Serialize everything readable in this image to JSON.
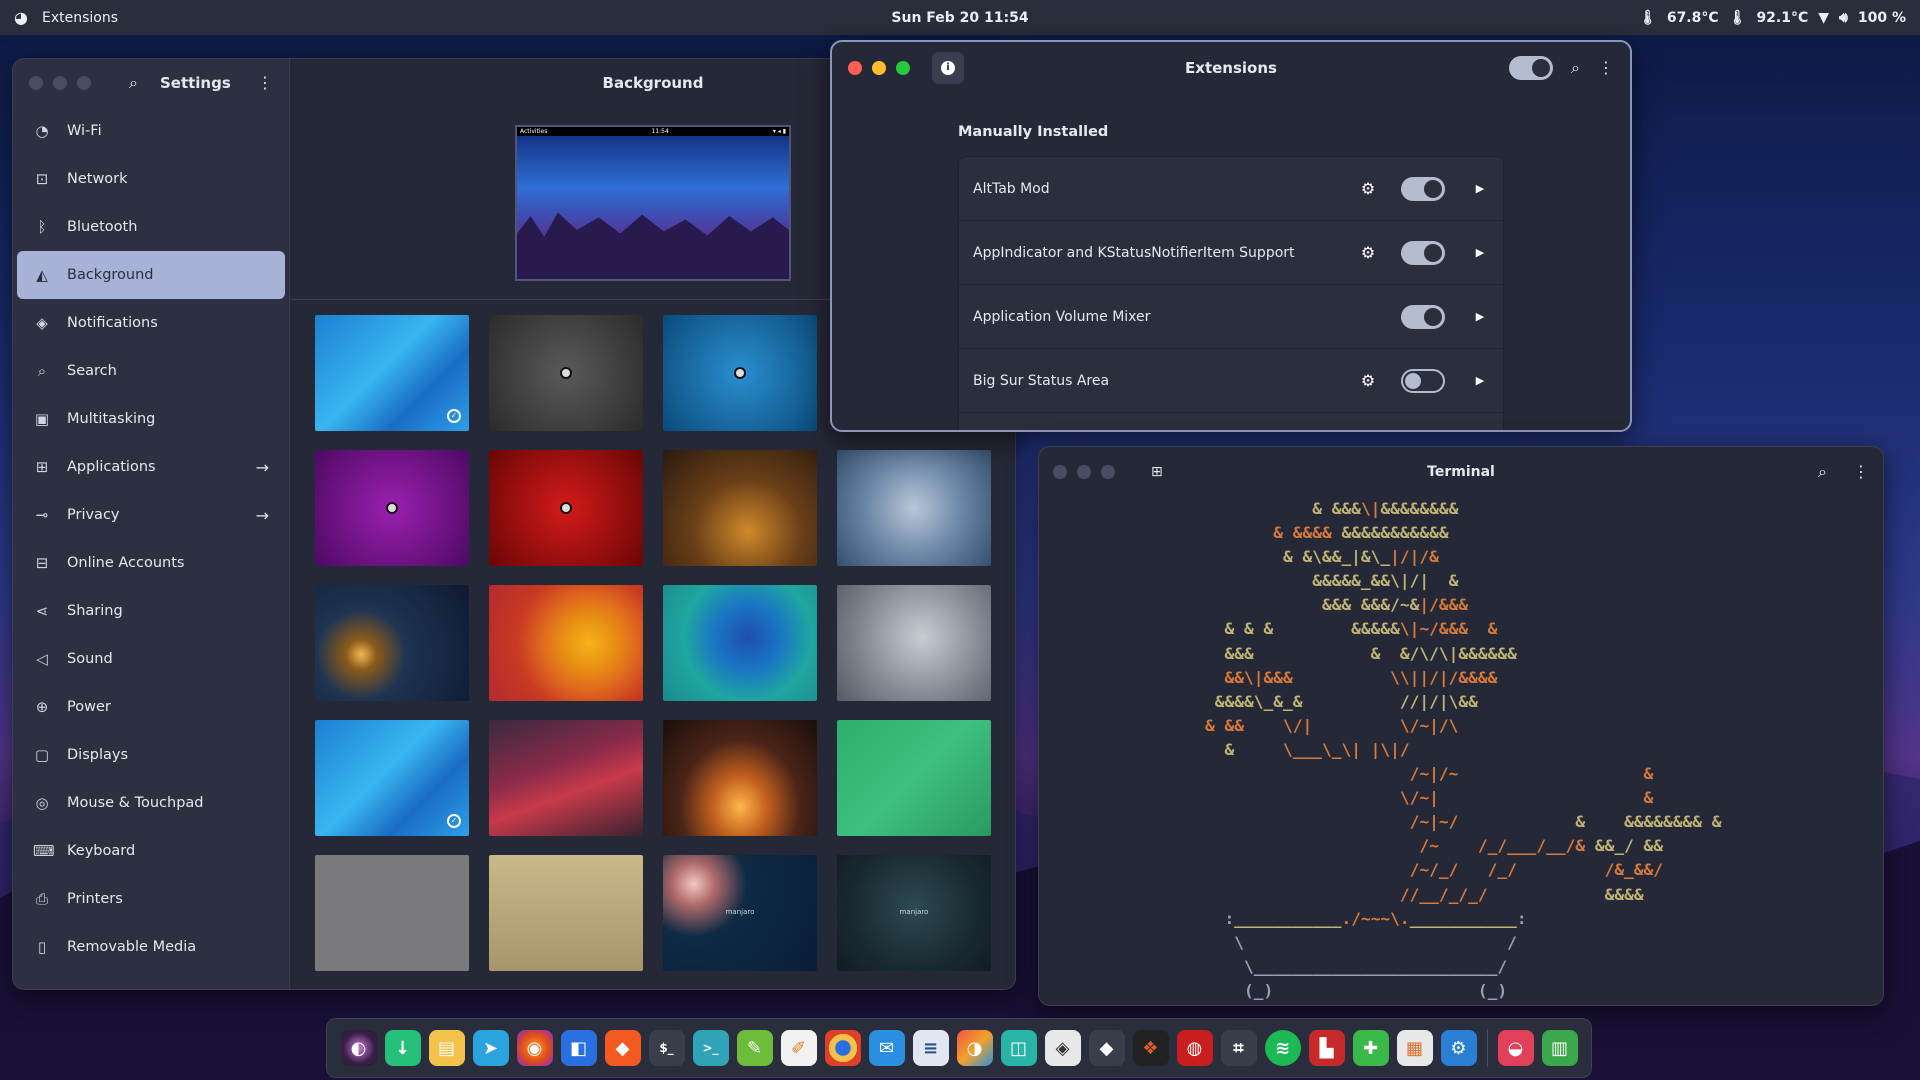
{
  "topbar": {
    "app_name": "Extensions",
    "clock": "Sun Feb 20  11:54",
    "temp_cpu": "67.8°C",
    "temp_gpu": "92.1°C",
    "battery": "100 %"
  },
  "settings": {
    "title": "Settings",
    "content_title": "Background",
    "preview_bar": {
      "left": "Activities",
      "center": "11:54"
    },
    "sidebar_items": [
      {
        "label": "Wi-Fi"
      },
      {
        "label": "Network"
      },
      {
        "label": "Bluetooth"
      },
      {
        "label": "Background"
      },
      {
        "label": "Notifications"
      },
      {
        "label": "Search"
      },
      {
        "label": "Multitasking"
      },
      {
        "label": "Applications"
      },
      {
        "label": "Privacy"
      },
      {
        "label": "Online Accounts"
      },
      {
        "label": "Sharing"
      },
      {
        "label": "Sound"
      },
      {
        "label": "Power"
      },
      {
        "label": "Displays"
      },
      {
        "label": "Mouse & Touchpad"
      },
      {
        "label": "Keyboard"
      },
      {
        "label": "Printers"
      },
      {
        "label": "Removable Media"
      }
    ],
    "wallpaper_brand": "manjaro"
  },
  "extensions": {
    "title": "Extensions",
    "section": "Manually Installed",
    "items": [
      {
        "name": "AltTab Mod",
        "enabled": true
      },
      {
        "name": "AppIndicator and KStatusNotifierItem Support",
        "enabled": true
      },
      {
        "name": "Application Volume Mixer",
        "enabled": true
      },
      {
        "name": "Big Sur Status Area",
        "enabled": false
      }
    ]
  },
  "terminal": {
    "title": "Terminal"
  },
  "colors": {
    "accent": "#a8b2d6",
    "panel": "#2a2d3b",
    "window_bg": "#252836",
    "ascii_green": "#c2b574",
    "ascii_orange": "#d97a3a"
  },
  "dock": {
    "icons": [
      "pop-icon",
      "download-icon",
      "files-icon",
      "telegram-icon",
      "firefox-icon",
      "store-icon",
      "brave-icon",
      "terminal-icon",
      "terminal2-icon",
      "inkscape-icon",
      "notes-icon",
      "chrome-icon",
      "mail-icon",
      "gtkhash-icon",
      "editor-icon",
      "screenshot-icon",
      "beekeeper-icon",
      "inkscape2-icon",
      "figma-icon",
      "steam-icon",
      "boxes-icon",
      "spotify-icon",
      "audio-icon",
      "extensions-icon",
      "tweaks-icon",
      "settings-icon",
      "github-icon",
      "trash-icon"
    ]
  }
}
